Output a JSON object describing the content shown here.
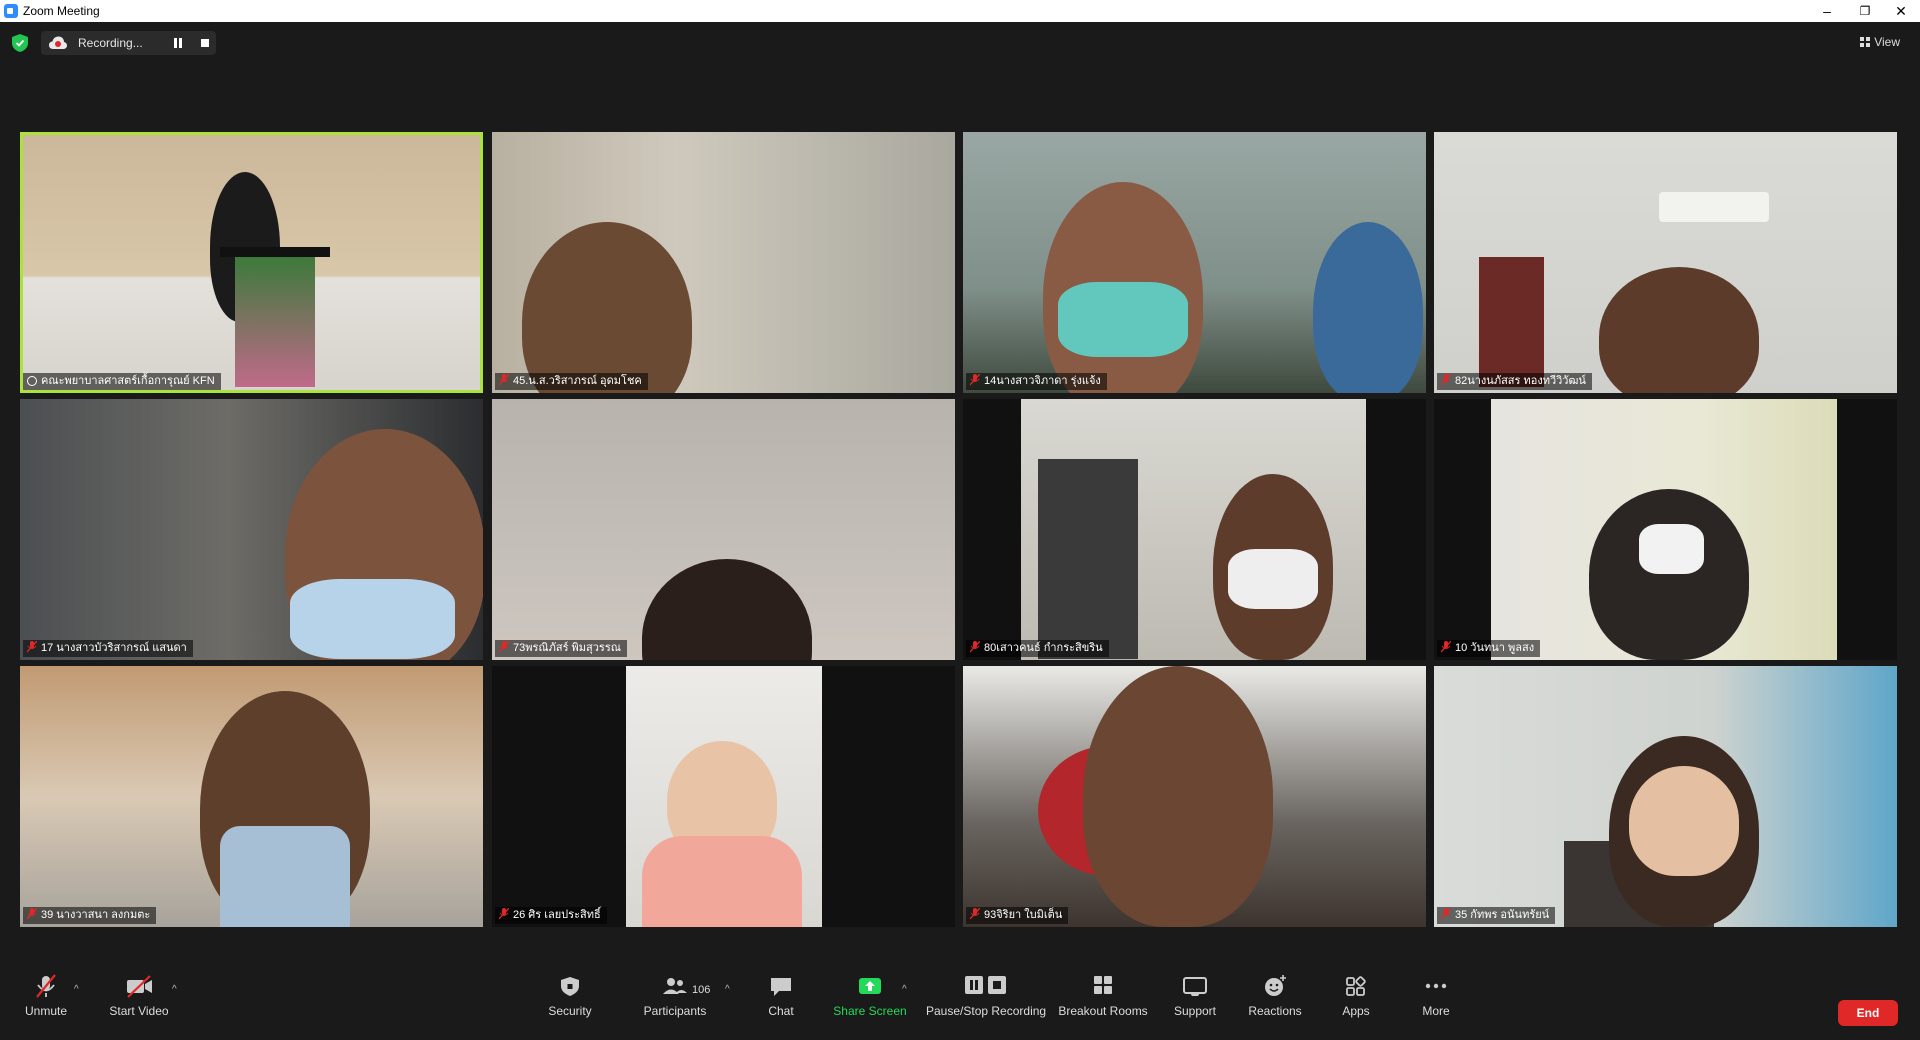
{
  "window": {
    "title": "Zoom Meeting"
  },
  "recording": {
    "label": "Recording..."
  },
  "view": {
    "label": "View"
  },
  "tiles": [
    {
      "name": "คณะพยาบาลศาสตร์เกื้อการุณย์ KFN",
      "active": true
    },
    {
      "name": "45.น.ส.วริสาภรณ์ อุดมโชค"
    },
    {
      "name": "14นางสาวจิภาดา รุ่งแจ้ง"
    },
    {
      "name": "82นางนภัสสร ทองทวีวิวัฒน์"
    },
    {
      "name": "17 นางสาวบัวริสากรณ์ แสนดา"
    },
    {
      "name": "73พรณิภัสร์ พิมสุวรรณ"
    },
    {
      "name": "80เสาวคนธ์ กำกระสิขริน"
    },
    {
      "name": "10 วันทนา พูลสง"
    },
    {
      "name": "39 นางวาสนา ลงกมตะ"
    },
    {
      "name": "26 ศิร เลยประสิทธิ์"
    },
    {
      "name": "93จิริยา ใบมิเต็น"
    },
    {
      "name": "35 กัทพร อนันทรัยน์"
    }
  ],
  "toolbar": {
    "unmute": "Unmute",
    "start_video": "Start Video",
    "security": "Security",
    "participants": "Participants",
    "participants_count": "106",
    "chat": "Chat",
    "share_screen": "Share Screen",
    "pause_stop": "Pause/Stop Recording",
    "breakout": "Breakout Rooms",
    "support": "Support",
    "reactions": "Reactions",
    "apps": "Apps",
    "more": "More",
    "end": "End"
  },
  "colors": {
    "active_speaker": "#a9e33b",
    "share_screen_green": "#23d959",
    "end_red": "#e02828",
    "muted_red": "#e02828"
  }
}
